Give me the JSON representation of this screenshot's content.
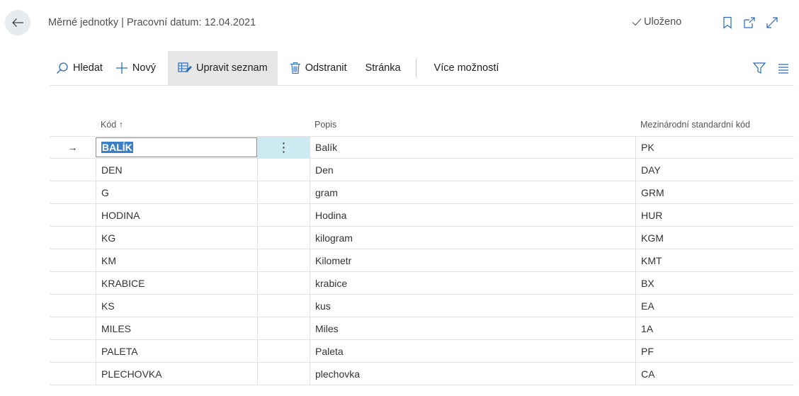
{
  "header": {
    "title": "Měrné jednotky | Pracovní datum: 12.04.2021",
    "saved_label": "Uloženo"
  },
  "toolbar": {
    "search_label": "Hledat",
    "new_label": "Nový",
    "edit_list_label": "Upravit seznam",
    "delete_label": "Odstranit",
    "page_label": "Stránka",
    "more_label": "Více možností"
  },
  "table": {
    "columns": {
      "code": "Kód ↑",
      "description": "Popis",
      "intl_code": "Mezinárodní standardní kód"
    },
    "rows": [
      {
        "code": "BALÍK",
        "description": "Balík",
        "intl_code": "PK"
      },
      {
        "code": "DEN",
        "description": "Den",
        "intl_code": "DAY"
      },
      {
        "code": "G",
        "description": "gram",
        "intl_code": "GRM"
      },
      {
        "code": "HODINA",
        "description": "Hodina",
        "intl_code": "HUR"
      },
      {
        "code": "KG",
        "description": "kilogram",
        "intl_code": "KGM"
      },
      {
        "code": "KM",
        "description": "Kilometr",
        "intl_code": "KMT"
      },
      {
        "code": "KRABICE",
        "description": "krabice",
        "intl_code": "BX"
      },
      {
        "code": "KS",
        "description": "kus",
        "intl_code": "EA"
      },
      {
        "code": "MILES",
        "description": "Miles",
        "intl_code": "1A"
      },
      {
        "code": "PALETA",
        "description": "Paleta",
        "intl_code": "PF"
      },
      {
        "code": "PLECHOVKA",
        "description": "plechovka",
        "intl_code": "CA"
      }
    ],
    "selected_row": 0,
    "row_actions_glyph": "⋮",
    "current_row_glyph": "→"
  },
  "icons": {
    "back": "arrow-left-icon",
    "saved": "checkmark-icon",
    "bookmark": "bookmark-icon",
    "open_new": "open-in-new-window-icon",
    "expand": "expand-icon",
    "search": "search-icon",
    "new": "plus-icon",
    "edit_list": "edit-list-icon",
    "delete": "trash-icon",
    "filter": "filter-icon",
    "list_view": "list-view-icon"
  },
  "colors": {
    "accent": "#3b7fc4",
    "active_button_bg": "#e6e6e6",
    "selected_cell_bg": "#cde9f1"
  }
}
